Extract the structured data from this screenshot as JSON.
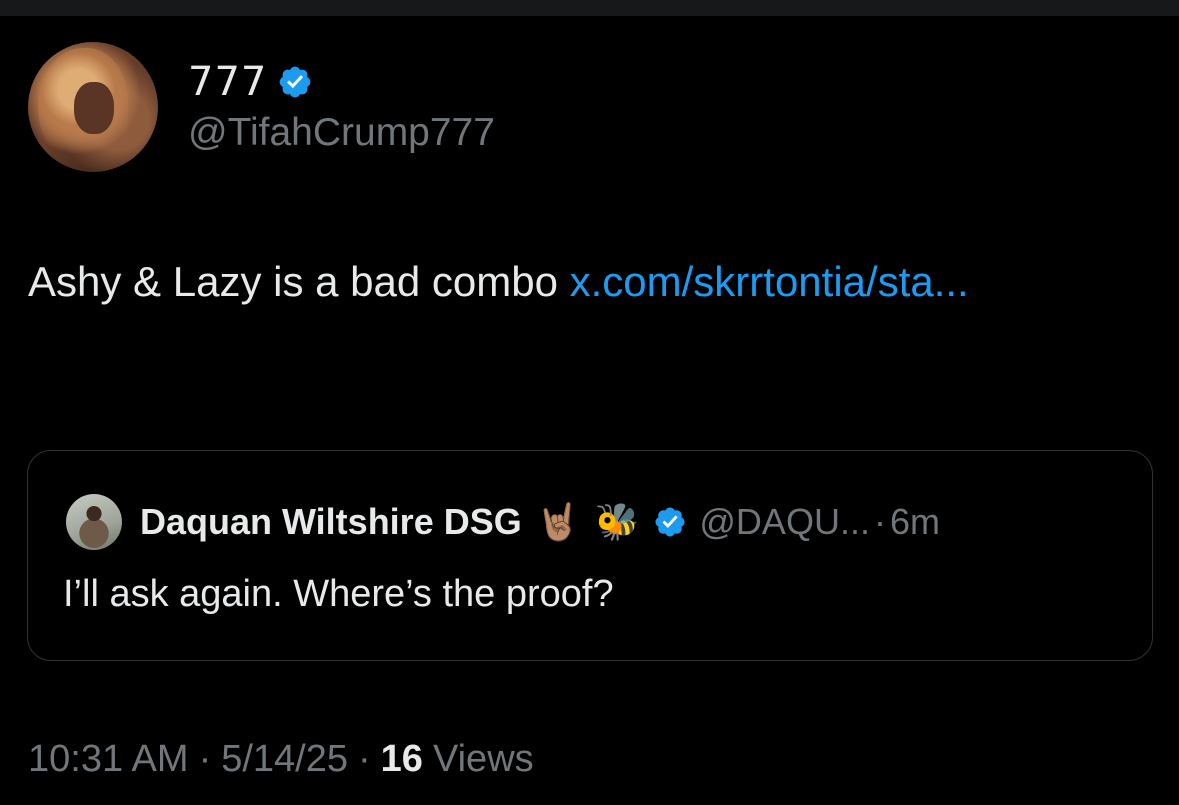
{
  "author": {
    "display_name": "777",
    "handle": "@TifahCrump777",
    "verified": true
  },
  "tweet": {
    "text": "Ashy & Lazy is a bad combo ",
    "link_text": "x.com/skrrtontia/sta..."
  },
  "quoted": {
    "display_name": "Daquan Wiltshire DSG",
    "emoji_1": "🤘🏽",
    "emoji_2": "🐝",
    "handle": "@DAQU...",
    "separator": "·",
    "time": "6m",
    "text": "I’ll ask again. Where’s the proof?"
  },
  "meta": {
    "time": "10:31 AM",
    "separator": "·",
    "date": "5/14/25",
    "views_count": "16",
    "views_label": "Views"
  },
  "colors": {
    "background": "#000000",
    "text": "#e7e9ea",
    "secondary": "#71767b",
    "link": "#1d9bf0",
    "border": "#2f3336"
  },
  "icons": {
    "verified": "verified-badge-icon"
  }
}
